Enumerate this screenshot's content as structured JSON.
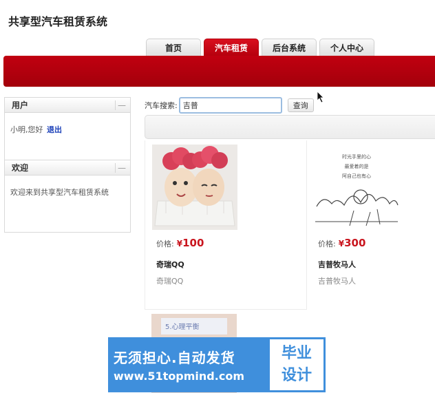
{
  "app_title": "共享型汽车租赁系统",
  "tabs": [
    {
      "label": "首页",
      "active": false
    },
    {
      "label": "汽车租赁",
      "active": true
    },
    {
      "label": "后台系统",
      "active": false
    },
    {
      "label": "个人中心",
      "active": false
    }
  ],
  "sidebar": {
    "user_panel": {
      "title": "用户",
      "greeting": "小明,您好",
      "logout": "退出",
      "collapse": "—"
    },
    "welcome_panel": {
      "title": "欢迎",
      "text": "欢迎来到共享型汽车租赁系统",
      "collapse": "—"
    }
  },
  "search": {
    "label": "汽车搜索:",
    "value": "吉普",
    "button": "查询"
  },
  "cards": [
    {
      "price_label": "价格:",
      "currency": "¥",
      "price": "100",
      "name": "奇瑞QQ",
      "subtitle": "奇瑞QQ",
      "image": "eggs-photo"
    },
    {
      "price_label": "价格:",
      "currency": "¥",
      "price": "300",
      "name": "吉普牧马人",
      "subtitle": "吉普牧马人",
      "image": "sketch-drawing",
      "image_text": [
        "时光手里的心",
        "最爱着的是",
        "阿自己也有心"
      ]
    }
  ],
  "partial_card": {
    "label": "5.心理平衡"
  },
  "watermark": {
    "line1": "无须担心.自动发货",
    "line2": "www.51topmind.com",
    "badge_top": "毕业",
    "badge_bottom": "设计"
  },
  "colors": {
    "accent_red": "#b4000d",
    "price_red": "#c9151e",
    "link_blue": "#1a3fb8",
    "watermark_blue": "#3f8fdc"
  }
}
